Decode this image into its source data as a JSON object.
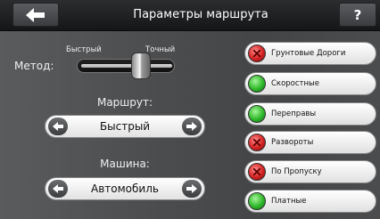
{
  "header": {
    "title": "Параметры маршрута",
    "help_label": "?"
  },
  "method": {
    "label": "Метод:",
    "fast_label": "Быстрый",
    "precise_label": "Точный",
    "slider_value_fraction": 0.6
  },
  "route": {
    "label": "Маршрут:",
    "value": "Быстрый"
  },
  "vehicle": {
    "label": "Машина:",
    "value": "Автомобиль"
  },
  "toggles": [
    {
      "label": "Грунтовые Дороги",
      "state": "off"
    },
    {
      "label": "Скоростные",
      "state": "on"
    },
    {
      "label": "Переправы",
      "state": "on"
    },
    {
      "label": "Развороты",
      "state": "off"
    },
    {
      "label": "По Пропуску",
      "state": "off"
    },
    {
      "label": "Платные",
      "state": "on"
    }
  ],
  "colors": {
    "on": "#2fb82a",
    "off": "#d42222"
  },
  "icons": {
    "back": "arrow-left-icon",
    "prev": "arrow-left-icon",
    "next": "arrow-right-icon"
  }
}
